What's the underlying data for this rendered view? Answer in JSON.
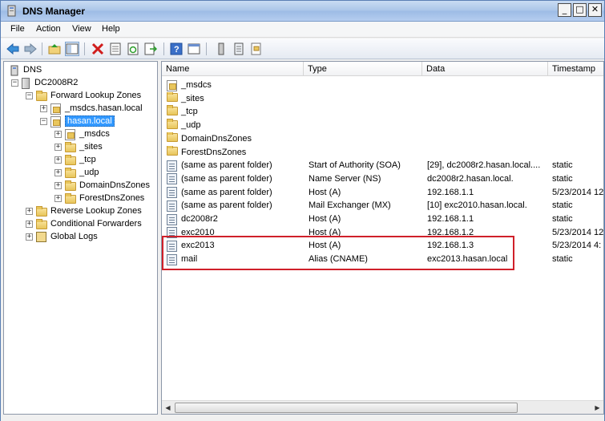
{
  "window": {
    "title": "DNS Manager"
  },
  "menu": [
    "File",
    "Action",
    "View",
    "Help"
  ],
  "toolbar": {
    "buttons": [
      "back-icon",
      "forward-icon",
      "up-folder-icon",
      "show-hide-tree-icon",
      "delete-icon",
      "properties-icon",
      "refresh-icon",
      "export-list-icon",
      "help-icon",
      "console-icon",
      "server-icon",
      "record-icon",
      "zone-icon"
    ]
  },
  "tree": {
    "root": "DNS",
    "server": "DC2008R2",
    "forward": "Forward Lookup Zones",
    "msdcs_zone": "_msdcs.hasan.local",
    "hasan_zone": "hasan.local",
    "children": [
      "_msdcs",
      "_sites",
      "_tcp",
      "_udp",
      "DomainDnsZones",
      "ForestDnsZones"
    ],
    "reverse": "Reverse Lookup Zones",
    "conditional": "Conditional Forwarders",
    "logs": "Global Logs"
  },
  "columns": [
    "Name",
    "Type",
    "Data",
    "Timestamp"
  ],
  "rows": [
    {
      "name": "_msdcs",
      "type": "",
      "data": "",
      "ts": "",
      "icon": "zone"
    },
    {
      "name": "_sites",
      "type": "",
      "data": "",
      "ts": "",
      "icon": "folder"
    },
    {
      "name": "_tcp",
      "type": "",
      "data": "",
      "ts": "",
      "icon": "folder"
    },
    {
      "name": "_udp",
      "type": "",
      "data": "",
      "ts": "",
      "icon": "folder"
    },
    {
      "name": "DomainDnsZones",
      "type": "",
      "data": "",
      "ts": "",
      "icon": "folder"
    },
    {
      "name": "ForestDnsZones",
      "type": "",
      "data": "",
      "ts": "",
      "icon": "folder"
    },
    {
      "name": "(same as parent folder)",
      "type": "Start of Authority (SOA)",
      "data": "[29], dc2008r2.hasan.local....",
      "ts": "static",
      "icon": "record"
    },
    {
      "name": "(same as parent folder)",
      "type": "Name Server (NS)",
      "data": "dc2008r2.hasan.local.",
      "ts": "static",
      "icon": "record"
    },
    {
      "name": "(same as parent folder)",
      "type": "Host (A)",
      "data": "192.168.1.1",
      "ts": "5/23/2014 12",
      "icon": "record"
    },
    {
      "name": "(same as parent folder)",
      "type": "Mail Exchanger (MX)",
      "data": "[10]  exc2010.hasan.local.",
      "ts": "static",
      "icon": "record"
    },
    {
      "name": "dc2008r2",
      "type": "Host (A)",
      "data": "192.168.1.1",
      "ts": "static",
      "icon": "record"
    },
    {
      "name": "exc2010",
      "type": "Host (A)",
      "data": "192.168.1.2",
      "ts": "5/23/2014 12",
      "icon": "record"
    },
    {
      "name": "exc2013",
      "type": "Host (A)",
      "data": "192.168.1.3",
      "ts": "5/23/2014 4:",
      "icon": "record"
    },
    {
      "name": "mail",
      "type": "Alias (CNAME)",
      "data": "exc2013.hasan.local",
      "ts": "static",
      "icon": "record"
    }
  ],
  "highlight_color": "#d0202a",
  "selection_color": "#3399ff"
}
